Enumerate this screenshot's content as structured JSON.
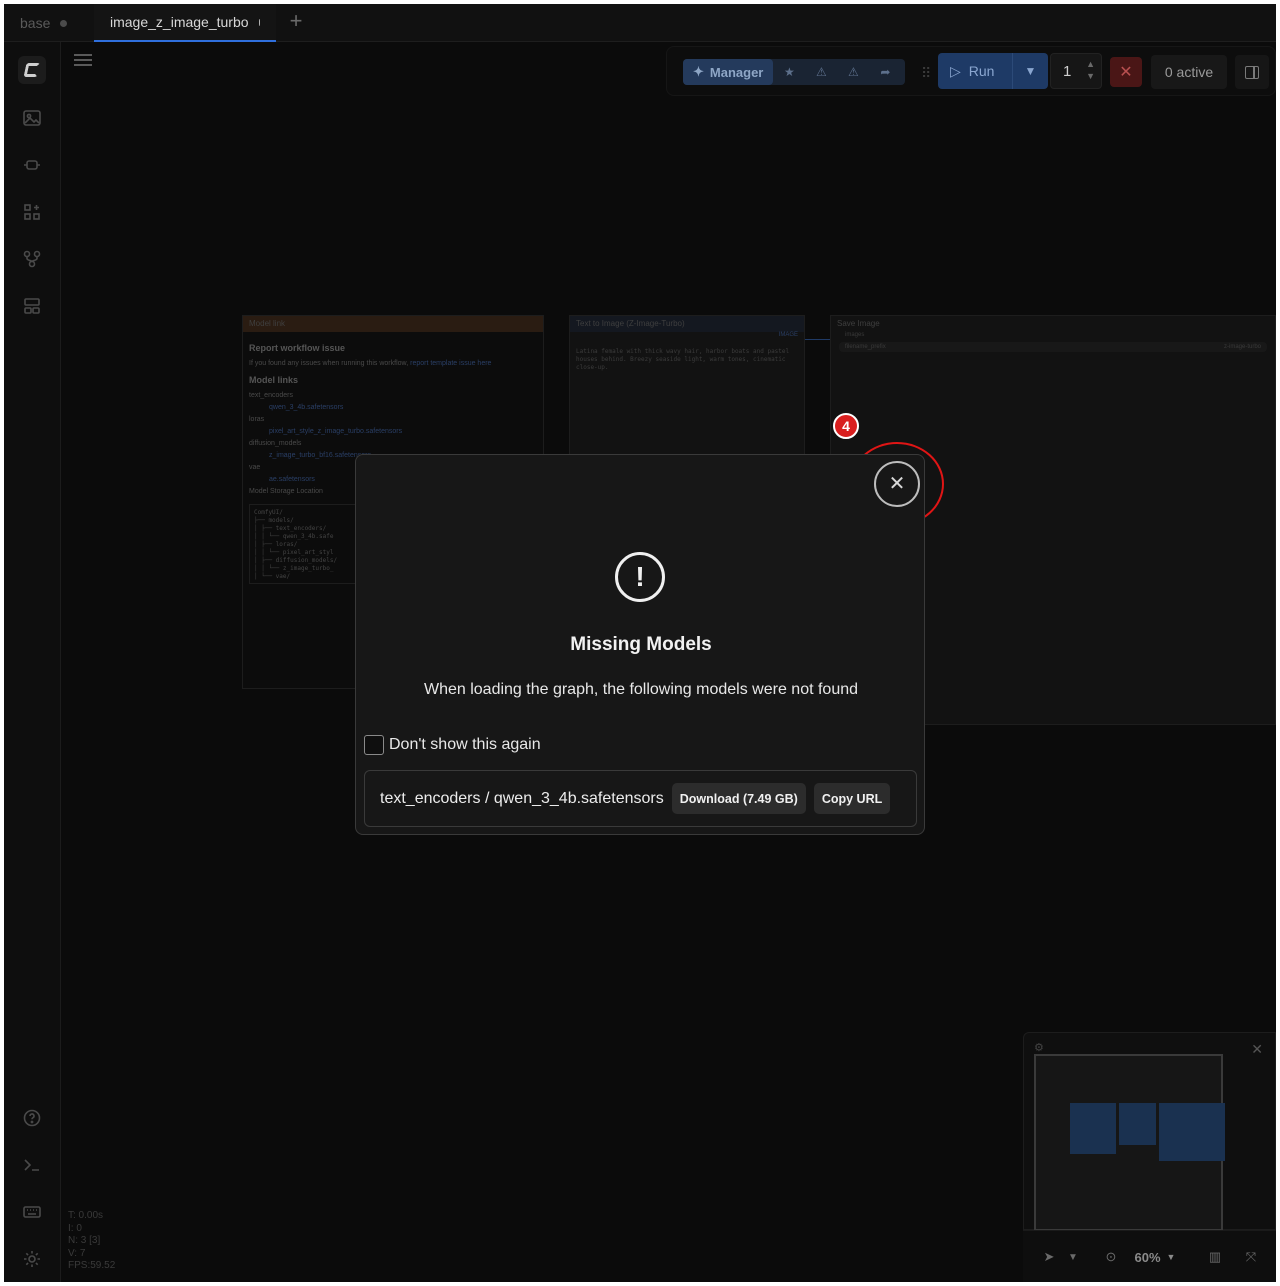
{
  "tabs": [
    {
      "label": "base"
    },
    {
      "label": "image_z_image_turbo"
    }
  ],
  "toolbar": {
    "manager_label": "Manager",
    "run_label": "Run",
    "queue_count": "1",
    "active_label": "0 active",
    "run_color": "#1e3a66"
  },
  "canvas": {
    "node1": {
      "title": "Model link",
      "heading": "Report workflow issue",
      "intro": "If you found any issues when running this workflow,",
      "intro_link": "report template issue here",
      "links_heading": "Model links",
      "sections": [
        {
          "name": "text_encoders",
          "file": "qwen_3_4b.safetensors"
        },
        {
          "name": "loras",
          "file": "pixel_art_style_z_image_turbo.safetensors"
        },
        {
          "name": "diffusion_models",
          "file": "z_image_turbo_bf16.safetensors"
        },
        {
          "name": "vae",
          "file": "ae.safetensors"
        }
      ],
      "storage_heading": "Model Storage Location",
      "tree": [
        "ComfyUI/",
        "├── models/",
        "│  ├── text_encoders/",
        "│  │  └── qwen_3_4b.safe",
        "│  ├── loras/",
        "│  │  └── pixel_art_styl",
        "│  ├── diffusion_models/",
        "│  │  └── z_image_turbo_",
        "│  └── vae/",
        "│     └── ae.safetensors"
      ]
    },
    "node2": {
      "title": "Text to Image (Z-Image-Turbo)",
      "port": "IMAGE",
      "prompt": "Latina female with thick wavy hair, harbor boats and pastel houses behind. Breezy seaside light, warm tones, cinematic close-up."
    },
    "node3": {
      "title": "Save Image",
      "port": "images",
      "field_label": "filename_prefix",
      "field_value": "z-image-turbo"
    }
  },
  "annotation": {
    "step_number": "4",
    "color": "#e01515"
  },
  "dialog": {
    "title": "Missing Models",
    "message": "When loading the graph, the following models were not found",
    "dont_show_label": "Don't show this again",
    "model_path": "text_encoders / qwen_3_4b.safetensors",
    "download_label": "Download (7.49 GB)",
    "copy_label": "Copy URL",
    "close_symbol": "✕",
    "alert_symbol": "!"
  },
  "stats": {
    "lines": [
      "T: 0.00s",
      "I: 0",
      "N: 3 [3]",
      "V: 7",
      "FPS:59.52"
    ]
  },
  "bottom_bar": {
    "zoom_label": "60%"
  }
}
